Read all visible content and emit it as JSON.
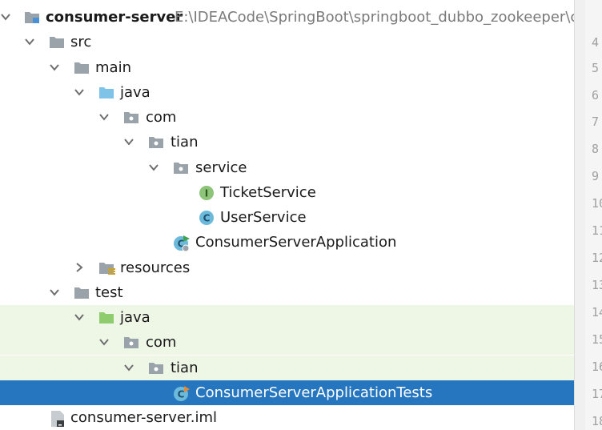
{
  "project": {
    "name": "consumer-server",
    "path": "E:\\IDEACode\\SpringBoot\\springboot_dubbo_zookeeper\\con"
  },
  "tree": {
    "src": "src",
    "main": "main",
    "java_main": "java",
    "com_main": "com",
    "tian_main": "tian",
    "service": "service",
    "ticket_service": "TicketService",
    "user_service": "UserService",
    "app": "ConsumerServerApplication",
    "resources": "resources",
    "test": "test",
    "java_test": "java",
    "com_test": "com",
    "tian_test": "tian",
    "app_tests": "ConsumerServerApplicationTests",
    "iml": "consumer-server.iml"
  },
  "icon_badges": {
    "interface": "I",
    "class": "C"
  },
  "gutter_numbers": [
    "4",
    "5",
    "6",
    "7",
    "8",
    "9",
    "10",
    "11",
    "12",
    "13",
    "14",
    "15",
    "16",
    "17",
    "18"
  ],
  "colors": {
    "selection": "#2675bf",
    "test_background": "#eef6e6",
    "folder": "#9aa3aa",
    "source_folder": "#7fc4e8",
    "test_folder": "#8fcc6e",
    "interface_badge": "#8ec47a",
    "class_badge": "#6bb9db"
  }
}
